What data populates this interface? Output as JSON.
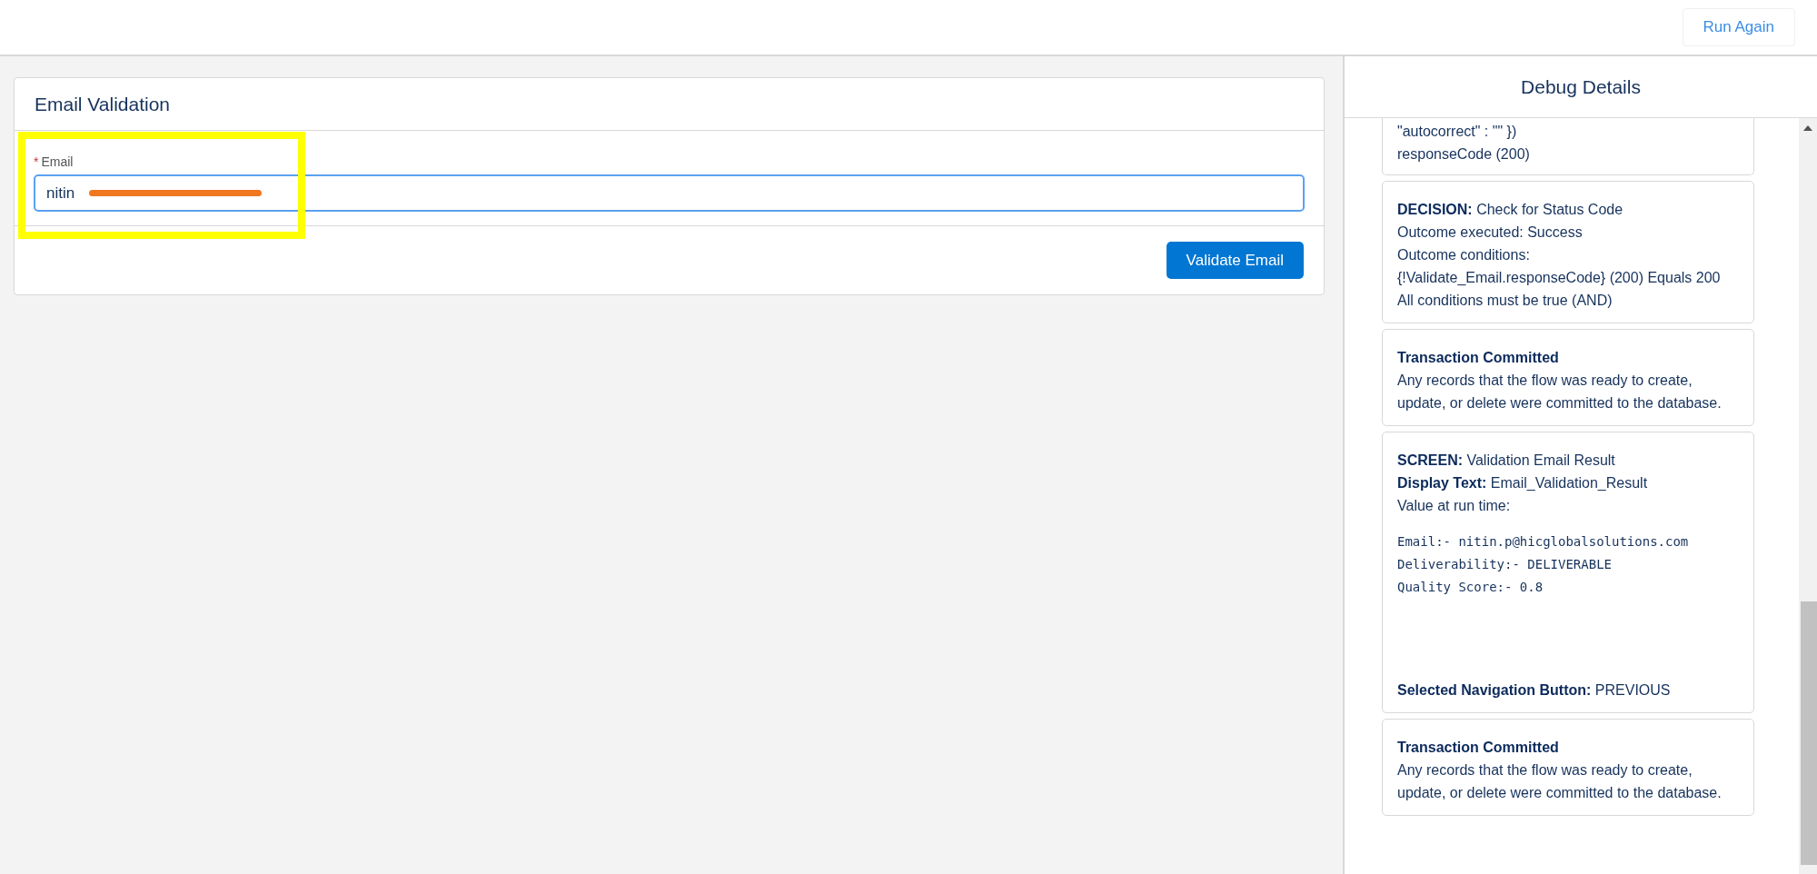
{
  "top_bar": {
    "run_again_button": "Run Again"
  },
  "form": {
    "title": "Email Validation",
    "field": {
      "required_marker": "*",
      "label": "Email",
      "value": "nitin"
    },
    "submit_button": "Validate Email"
  },
  "annotations": {
    "highlight_frame": true,
    "redaction_stroke": true
  },
  "debug": {
    "title": "Debug Details",
    "cards": [
      {
        "lines": [
          {
            "kind": "text",
            "text": "\"autocorrect\" : \"\" })"
          },
          {
            "kind": "text",
            "text": "responseCode (200)"
          }
        ]
      },
      {
        "lines": [
          {
            "kind": "text",
            "label": "DECISION:",
            "text": "Check for Status Code"
          },
          {
            "kind": "text",
            "text": "Outcome executed: Success"
          },
          {
            "kind": "text",
            "text": "Outcome conditions:"
          },
          {
            "kind": "text",
            "text": "{!Validate_Email.responseCode} (200) Equals 200"
          },
          {
            "kind": "text",
            "text": "All conditions must be true (AND)"
          }
        ]
      },
      {
        "lines": [
          {
            "kind": "heading",
            "text": "Transaction Committed"
          },
          {
            "kind": "text",
            "text": "Any records that the flow was ready to create, update, or delete were committed to the database."
          }
        ]
      },
      {
        "lines": [
          {
            "kind": "text",
            "label": "SCREEN:",
            "text": "Validation Email Result"
          },
          {
            "kind": "text",
            "label": "Display Text:",
            "text": "Email_Validation_Result"
          },
          {
            "kind": "text",
            "text": "Value at run time:"
          },
          {
            "kind": "code",
            "text": "Email:- nitin.p@hicglobalsolutions.com"
          },
          {
            "kind": "code",
            "text": "Deliverability:- DELIVERABLE"
          },
          {
            "kind": "code",
            "text": "Quality Score:- 0.8"
          },
          {
            "kind": "footer",
            "label": "Selected Navigation Button:",
            "text": "PREVIOUS"
          }
        ]
      },
      {
        "lines": [
          {
            "kind": "heading",
            "text": "Transaction Committed"
          },
          {
            "kind": "text",
            "text": "Any records that the flow was ready to create, update, or delete were committed to the database."
          }
        ]
      }
    ]
  }
}
